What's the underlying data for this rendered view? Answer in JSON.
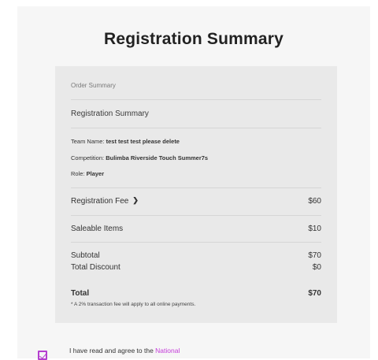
{
  "page": {
    "title": "Registration Summary"
  },
  "summary": {
    "order_label": "Order Summary",
    "section_title": "Registration Summary",
    "details": [
      {
        "label": "Team Name:",
        "value": "test test test please delete"
      },
      {
        "label": "Competition:",
        "value": "Bulimba Riverside Touch Summer7s"
      },
      {
        "label": "Role:",
        "value": "Player"
      }
    ],
    "fee": {
      "label": "Registration Fee",
      "amount": "$60",
      "expand_icon": "chevron-down-icon"
    },
    "saleable": {
      "label": "Saleable Items",
      "amount": "$10"
    },
    "subtotal": {
      "label": "Subtotal",
      "amount": "$70"
    },
    "discount": {
      "label": "Total Discount",
      "amount": "$0"
    },
    "total": {
      "label": "Total",
      "amount": "$70"
    },
    "note": "* A 2% transaction fee will apply to all online payments."
  },
  "agreement": {
    "checked": true,
    "text": "I have read and agree to the ",
    "link": "National"
  },
  "colors": {
    "accent": "#c43bd9",
    "card": "#e9e9e9",
    "panel": "#f6f6f6"
  }
}
